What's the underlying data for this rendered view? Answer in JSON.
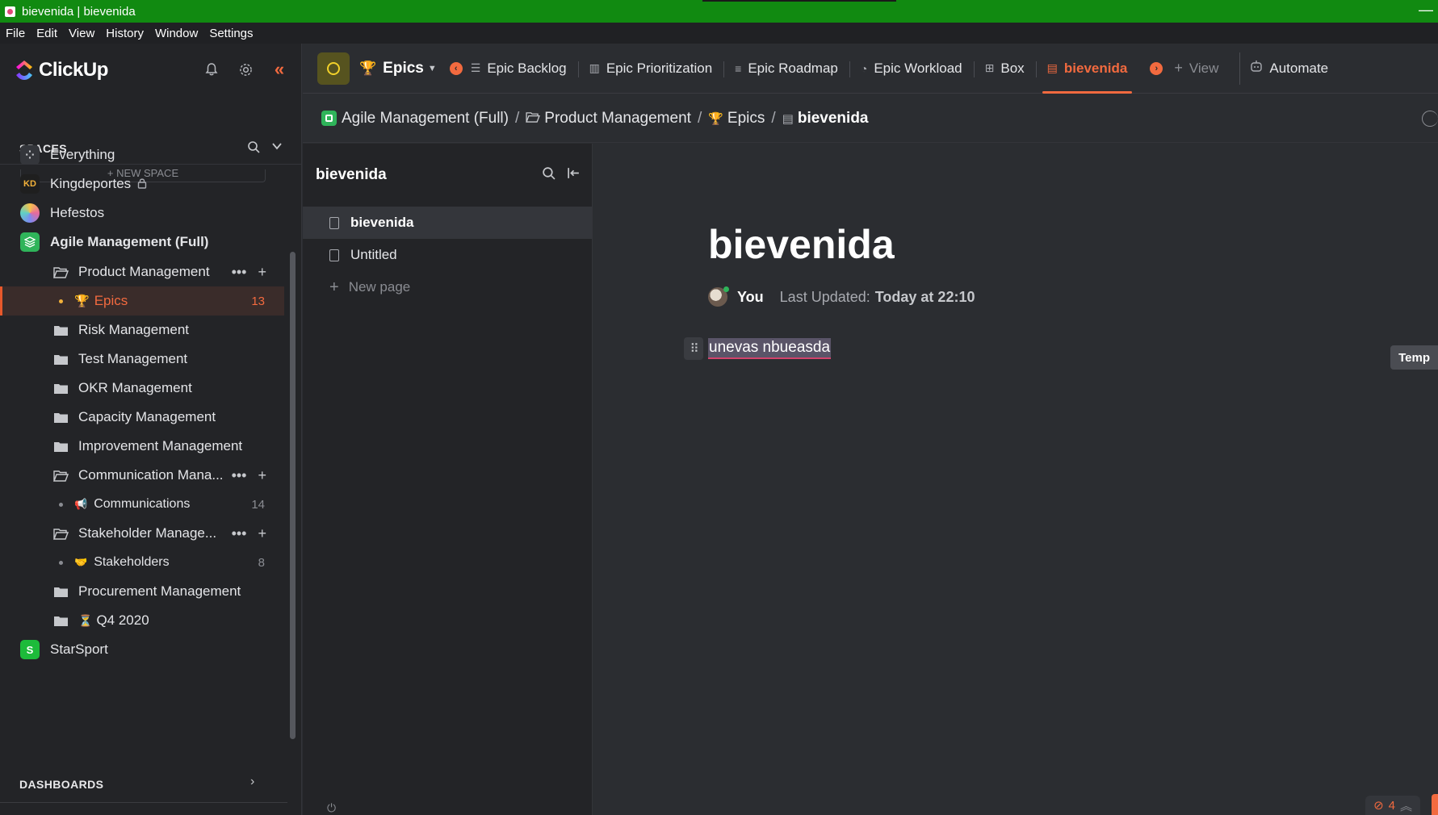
{
  "window": {
    "title": "bievenida | bievenida"
  },
  "menu": [
    "File",
    "Edit",
    "View",
    "History",
    "Window",
    "Settings"
  ],
  "brand": {
    "name": "ClickUp"
  },
  "sidebar": {
    "spaces_heading": "SPACES",
    "new_space_label": "+ NEW SPACE",
    "items": [
      {
        "label": "Everything",
        "icon": "grid-icon"
      },
      {
        "label": "Kingdeportes",
        "icon": "kd-logo-icon"
      },
      {
        "label": "Hefestos",
        "icon": "hefestos-logo-icon"
      },
      {
        "label": "Agile Management (Full)",
        "icon": "layers-icon"
      },
      {
        "label": "Product Management",
        "icon": "folder-open-icon"
      },
      {
        "label": "Epics",
        "icon": "trophy-icon",
        "count": "13"
      },
      {
        "label": "Risk Management",
        "icon": "folder-icon"
      },
      {
        "label": "Test Management",
        "icon": "folder-icon"
      },
      {
        "label": "OKR Management",
        "icon": "folder-icon"
      },
      {
        "label": "Capacity Management",
        "icon": "folder-icon"
      },
      {
        "label": "Improvement Management",
        "icon": "folder-icon"
      },
      {
        "label": "Communication Mana...",
        "icon": "folder-open-icon"
      },
      {
        "label": "Communications",
        "icon": "megaphone-icon",
        "count": "14"
      },
      {
        "label": "Stakeholder Manage...",
        "icon": "folder-open-icon"
      },
      {
        "label": "Stakeholders",
        "icon": "handshake-icon",
        "count": "8"
      },
      {
        "label": "Procurement Management",
        "icon": "folder-icon"
      },
      {
        "label": "Q4 2020",
        "icon": "hourglass-icon"
      },
      {
        "label": "StarSport",
        "icon": "s-avatar-icon",
        "avatar_letter": "S"
      }
    ],
    "dashboards_heading": "DASHBOARDS"
  },
  "topbar": {
    "list_title": "Epics",
    "views": [
      "Epic Backlog",
      "Epic Prioritization",
      "Epic Roadmap",
      "Epic Workload",
      "Box",
      "bievenida"
    ],
    "add_view": "View",
    "automate": "Automate"
  },
  "breadcrumb": {
    "space": "Agile Management (Full)",
    "folder": "Product Management",
    "list": "Epics",
    "doc": "bievenida"
  },
  "doc_nav": {
    "title": "bievenida",
    "pages": [
      "bievenida",
      "Untitled"
    ],
    "new_page": "New page"
  },
  "doc": {
    "title": "bievenida",
    "author": "You",
    "updated_label": "Last Updated:",
    "updated_value": "Today at 22:10",
    "body_text": "unevas nbueasda",
    "tooltip": "Temp",
    "badge_count": "4"
  },
  "colors": {
    "accent": "#f26a3f",
    "titlebar": "#118a11",
    "sidebar_bg": "#232427",
    "main_bg": "#2b2d31"
  }
}
